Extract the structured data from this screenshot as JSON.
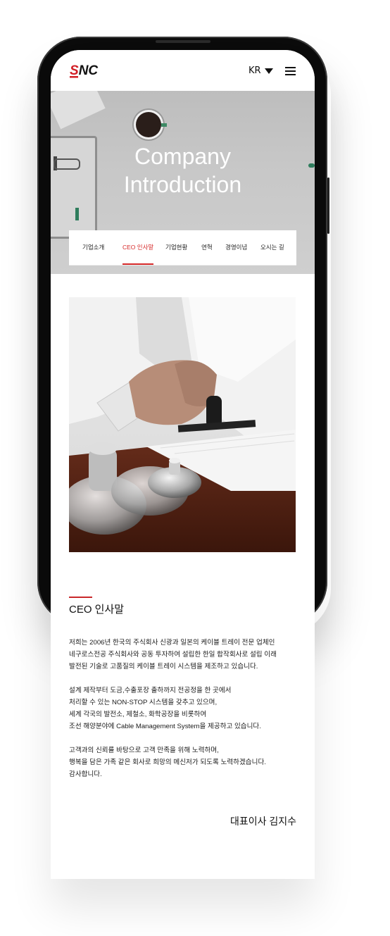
{
  "header": {
    "logo_text": "SNC",
    "lang": "KR"
  },
  "hero": {
    "title_line1": "Company",
    "title_line2": "Introduction"
  },
  "tabs": [
    {
      "label": "기업소개",
      "active": false
    },
    {
      "label": "CEO 인사말",
      "active": true
    },
    {
      "label": "기업현황",
      "active": false
    },
    {
      "label": "연혁",
      "active": false
    },
    {
      "label": "경영이념",
      "active": false
    },
    {
      "label": "오시는 길",
      "active": false
    }
  ],
  "section": {
    "title": "CEO 인사말",
    "paragraph1": [
      "저희는 2006년 한국의 주식회사 신광과 일본의 케이블 트레이 전문 업체인",
      "네구로스전공 주식회사와 공동 투자하여 설립한 한일 합작회사로 설립 이래",
      "발전된 기술로 고품질의 케이블 트레이 시스템을 제조하고 있습니다."
    ],
    "paragraph2": [
      "설계 제작부터 도금,수출포장 출하까지 전공정을 한 곳에서",
      "처리할 수 있는 NON-STOP 시스템을 갖추고 있으며,",
      "세계 각국의 발전소, 제철소, 화학공장을 비롯하여",
      "조선 해양분야에 Cable Management System을 제공하고 있습니다."
    ],
    "paragraph3": [
      "고객과의 신뢰를 바탕으로 고객 만족을 위해 노력하며,",
      "행복을 담은 가족 같은 회사로 희망의 메신저가 되도록 노력하겠습니다.",
      "감사합니다."
    ],
    "signature": "대표이사 김지수"
  },
  "colors": {
    "accent": "#d62a2a",
    "logo_red": "#d21f26"
  }
}
